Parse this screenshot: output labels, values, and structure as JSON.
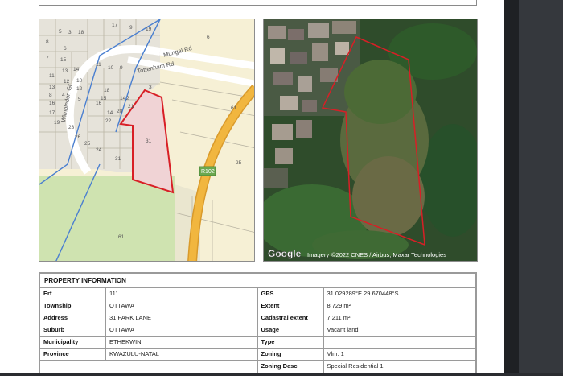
{
  "map": {
    "roads": [
      "Mungal Rd",
      "Tottenham Rd",
      "Wimbledon Gr",
      "R102"
    ],
    "erf_numbers": [
      "5",
      "3",
      "18",
      "17",
      "9",
      "19",
      "8",
      "7",
      "6",
      "6",
      "15",
      "13",
      "12",
      "14",
      "11",
      "10",
      "9",
      "11",
      "13",
      "12",
      "10",
      "8",
      "4",
      "5",
      "16",
      "15",
      "14",
      "17",
      "16",
      "18",
      "19",
      "20",
      "21",
      "23",
      "22",
      "26",
      "25",
      "24",
      "3",
      "2",
      "31",
      "31",
      "61",
      "25",
      "61"
    ],
    "colors": {
      "land": "#f6f0d5",
      "park": "#cfe3b0",
      "road": "#f1b63f",
      "boundary": "#d81f26",
      "municipal": "#4a7fd0"
    }
  },
  "satellite": {
    "attribution": "©2022 CNES / Airbus, Maxar Technologies",
    "attribution_prefix": "Imagery ",
    "google_logo": "Google"
  },
  "property": {
    "title": "PROPERTY INFORMATION",
    "left": [
      {
        "key": "Erf",
        "value": "111"
      },
      {
        "key": "Township",
        "value": "OTTAWA"
      },
      {
        "key": "Address",
        "value": "31 PARK LANE"
      },
      {
        "key": "Suburb",
        "value": "OTTAWA"
      },
      {
        "key": "Municipality",
        "value": "ETHEKWINI"
      },
      {
        "key": "Province",
        "value": "KWAZULU-NATAL"
      }
    ],
    "right": [
      {
        "key": "GPS",
        "value": "31.029289°E   29.670448°S"
      },
      {
        "key": "Extent",
        "value": "8 729 m²"
      },
      {
        "key": "Cadastral extent",
        "value": "7 211 m²"
      },
      {
        "key": "Usage",
        "value": "Vacant land"
      },
      {
        "key": "Type",
        "value": ""
      },
      {
        "key": "Zoning",
        "value": "Vlm: 1"
      },
      {
        "key": "Zoning Desc",
        "value": "Special Residential 1"
      }
    ]
  }
}
